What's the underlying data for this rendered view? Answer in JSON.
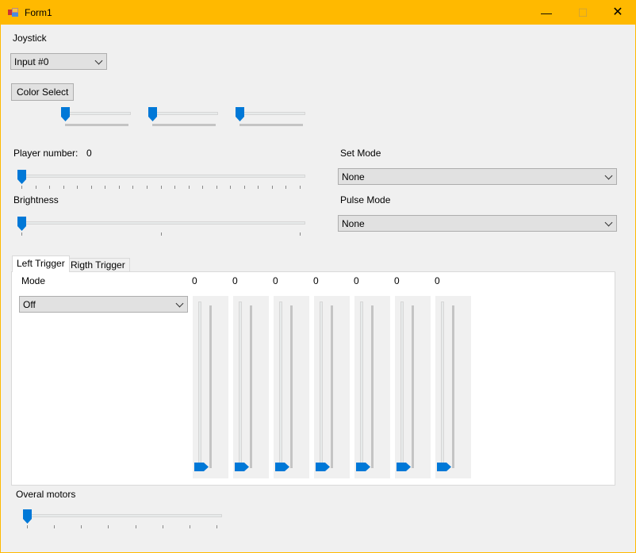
{
  "window": {
    "title": "Form1",
    "controls": [
      "minimize",
      "maximize",
      "close"
    ]
  },
  "joystick": {
    "label": "Joystick",
    "selected": "Input #0"
  },
  "color_select": {
    "label": "Color Select",
    "sliders": [
      0,
      0,
      0
    ]
  },
  "player": {
    "label": "Player number:",
    "value": "0",
    "slider_value": 0
  },
  "brightness": {
    "label": "Brightness",
    "slider_value": 0
  },
  "set_mode": {
    "label": "Set Mode",
    "selected": "None"
  },
  "pulse_mode": {
    "label": "Pulse Mode",
    "selected": "None"
  },
  "tabs": [
    {
      "label": "Left Trigger",
      "selected": true
    },
    {
      "label": "Rigth Trigger",
      "selected": false
    }
  ],
  "trigger": {
    "mode_label": "Mode",
    "mode_selected": "Off",
    "values": [
      "0",
      "0",
      "0",
      "0",
      "0",
      "0",
      "0"
    ]
  },
  "overall": {
    "label": "Overal motors",
    "slider_value": 0
  },
  "colors": {
    "accent": "#0078d7",
    "titlebar": "#ffb900"
  }
}
